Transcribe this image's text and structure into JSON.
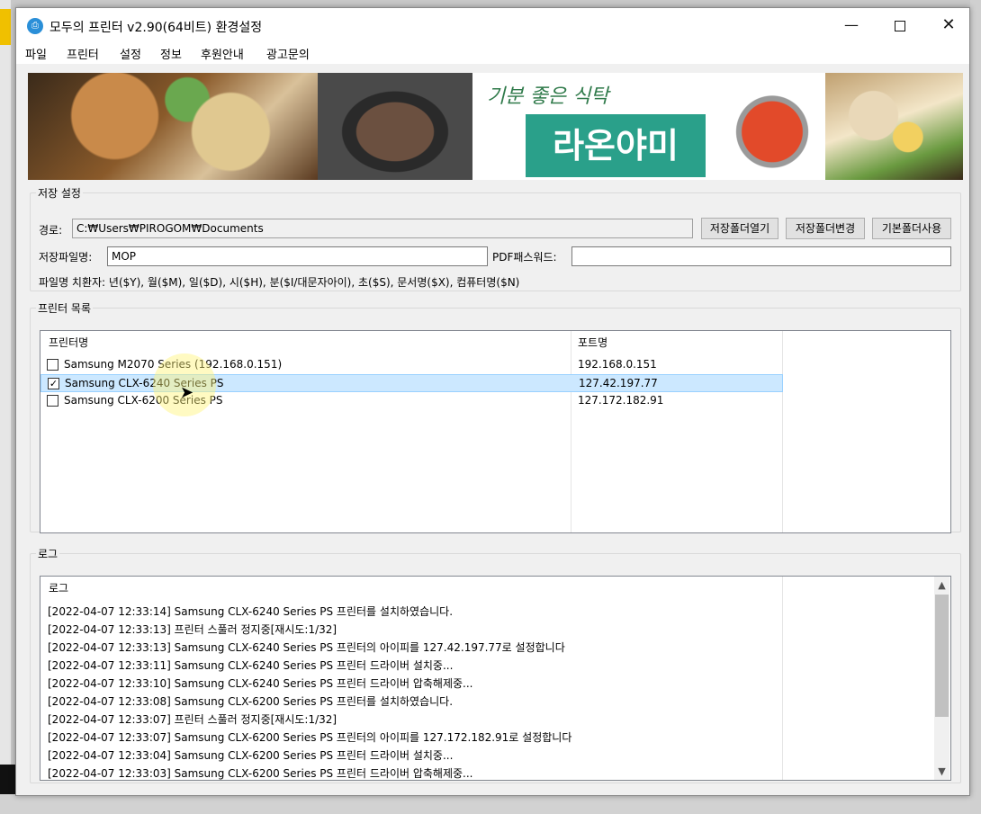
{
  "window": {
    "title": "모두의 프린터 v2.90(64비트) 환경설정",
    "app_icon": "printer-icon",
    "controls": {
      "minimize": "—",
      "close": "✕"
    }
  },
  "menu": [
    "파일",
    "프린터",
    "설정",
    "정보",
    "후원안내",
    "광고문의"
  ],
  "banner": {
    "slogan": "기분 좋은 식탁",
    "brand": "라온야미"
  },
  "save_settings": {
    "legend": "저장 설정",
    "path_label": "경로:",
    "path_value": "C:₩Users₩PIROGOM₩Documents",
    "open_folder_button": "저장폴더열기",
    "change_folder_button": "저장폴더변경",
    "default_folder_button": "기본폴더사용",
    "filename_label": "저장파일명:",
    "filename_value": "MOP",
    "pdf_password_label": "PDF패스워드:",
    "pdf_password_value": "",
    "substitution_help": "파일명 치환자: 년($Y), 월($M), 일($D), 시($H), 분($I/대문자아이), 초($S), 문서명($X), 컴퓨터명($N)"
  },
  "printer_list": {
    "legend": "프린터 목록",
    "columns": [
      "프린터명",
      "포트명"
    ],
    "rows": [
      {
        "name": "Samsung M2070 Series (192.168.0.151)",
        "port": "192.168.0.151",
        "checked": false,
        "check_mark": ""
      },
      {
        "name": "Samsung CLX-6240 Series PS",
        "port": "127.42.197.77",
        "checked": true,
        "check_mark": "✓"
      },
      {
        "name": "Samsung CLX-6200 Series PS",
        "port": "127.172.182.91",
        "checked": false,
        "check_mark": ""
      }
    ]
  },
  "log": {
    "legend": "로그",
    "column": "로그",
    "lines": [
      "[2022-04-07 12:33:14] Samsung CLX-6240 Series PS 프린터를 설치하였습니다.",
      "[2022-04-07 12:33:13] 프린터 스풀러 정지중[재시도:1/32]",
      "[2022-04-07 12:33:13] Samsung CLX-6240 Series PS 프린터의 아이피를 127.42.197.77로 설정합니다",
      "[2022-04-07 12:33:11] Samsung CLX-6240 Series PS 프린터 드라이버 설치중...",
      "[2022-04-07 12:33:10] Samsung CLX-6240 Series PS 프린터 드라이버 압축해제중...",
      "[2022-04-07 12:33:08] Samsung CLX-6200 Series PS 프린터를 설치하였습니다.",
      "[2022-04-07 12:33:07] 프린터 스풀러 정지중[재시도:1/32]",
      "[2022-04-07 12:33:07] Samsung CLX-6200 Series PS 프린터의 아이피를 127.172.182.91로 설정합니다",
      "[2022-04-07 12:33:04] Samsung CLX-6200 Series PS 프린터 드라이버 설치중...",
      "[2022-04-07 12:33:03] Samsung CLX-6200 Series PS 프린터 드라이버 압축해제중..."
    ],
    "scroll_up": "▲",
    "scroll_down": "▼"
  }
}
